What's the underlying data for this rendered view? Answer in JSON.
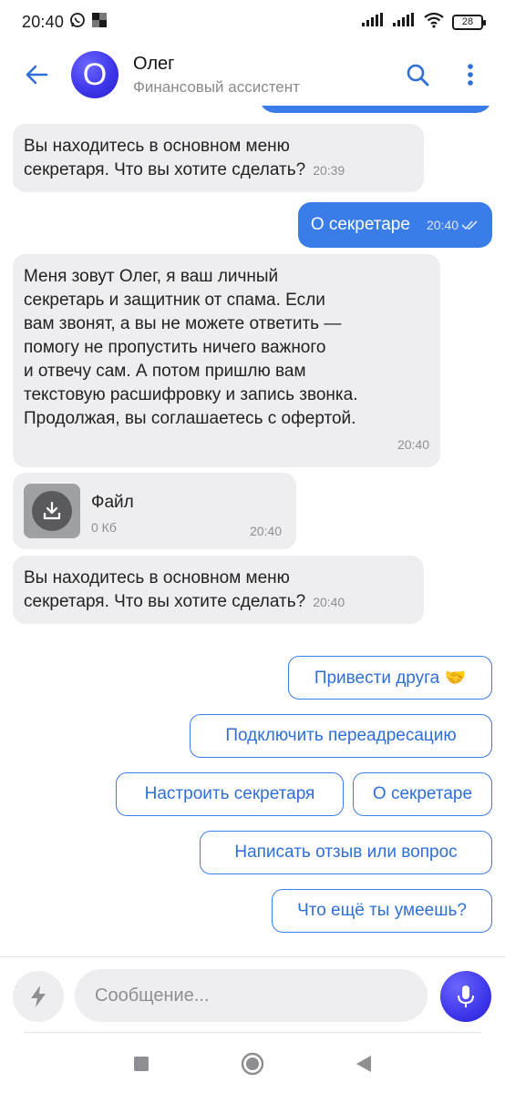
{
  "status_bar": {
    "time": "20:40",
    "battery": "28"
  },
  "header": {
    "avatar_letter": "О",
    "name": "Олег",
    "subtitle": "Финансовый ассистент"
  },
  "messages": [
    {
      "type": "incoming",
      "text": "Вы находитесь в основном меню\nсекретаря. Что вы хотите сделать?",
      "time": "20:39"
    },
    {
      "type": "outgoing",
      "text": "О секретаре",
      "time": "20:40"
    },
    {
      "type": "incoming",
      "text": "Меня зовут Олег, я ваш личный\nсекретарь и защитник от спама. Если\nвам звонят, а вы не можете ответить —\nпомогу не пропустить ничего важного\nи отвечу сам. А потом пришлю вам\nтекстовую расшифровку и запись звонка.\nПродолжая, вы соглашаетесь с офертой.",
      "time": "20:40"
    },
    {
      "type": "file",
      "name": "Файл",
      "size": "0 Кб",
      "time": "20:40"
    },
    {
      "type": "incoming",
      "text": "Вы находитесь в основном меню\nсекретаря. Что вы хотите сделать?",
      "time": "20:40"
    }
  ],
  "quick_replies": [
    "Привести друга 🤝",
    "Подключить переадресацию",
    "Настроить секретаря",
    "О секретаре",
    "Написать отзыв или вопрос",
    "Что ещё ты умеешь?"
  ],
  "input": {
    "placeholder": "Сообщение..."
  },
  "colors": {
    "accent": "#3a7ce8",
    "avatar": "#3b33e8",
    "bubble_in": "#eeeef0"
  }
}
